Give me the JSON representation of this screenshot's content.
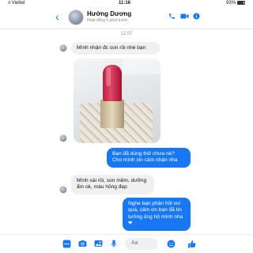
{
  "status_bar": {
    "carrier": "ıl Viettel",
    "time": "11:16",
    "battery": "93%"
  },
  "header": {
    "name": "Hướng Dương",
    "status": "Hoạt động 5 phút trước"
  },
  "timestamp": "12:07",
  "messages": [
    {
      "dir": "in",
      "text": "Mình nhận đc son rồi nhé bạn"
    },
    {
      "dir": "out",
      "text": "Bạn đã dùng thử chưa nè? Cho mình xin cảm nhận nha"
    },
    {
      "dir": "in",
      "text": "Mình xài rồi, son mềm, dưỡng ẩm ok, màu hồng đẹp"
    },
    {
      "dir": "out",
      "text": "Nghe bạn phản hồi vui quá, cảm ơn bạn đã tin tưởng ủng hộ mình nha ❤"
    }
  ],
  "composer": {
    "placeholder": "Aa"
  },
  "icons": {
    "back": "chevron-left-icon",
    "call": "phone-icon",
    "video": "video-icon",
    "info": "info-icon"
  },
  "colors": {
    "accent": "#1877f2",
    "incoming_bg": "#f0f0f0"
  }
}
